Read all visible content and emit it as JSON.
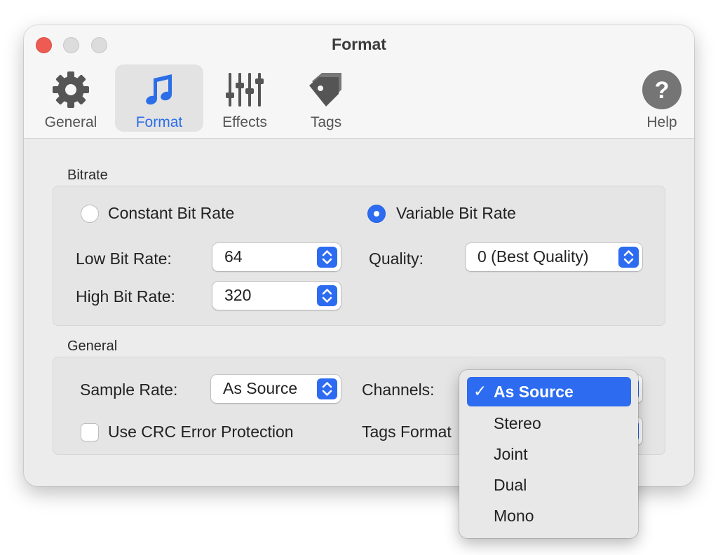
{
  "window": {
    "title": "Format"
  },
  "toolbar": {
    "tabs": [
      {
        "label": "General",
        "icon": "gear-icon"
      },
      {
        "label": "Format",
        "icon": "music-note-icon"
      },
      {
        "label": "Effects",
        "icon": "sliders-icon"
      },
      {
        "label": "Tags",
        "icon": "tag-icon"
      }
    ],
    "active_tab": "Format",
    "help": {
      "label": "Help",
      "icon": "help-icon"
    }
  },
  "bitrate": {
    "section_label": "Bitrate",
    "constant_label": "Constant Bit Rate",
    "variable_label": "Variable Bit Rate",
    "selected_mode": "Variable Bit Rate",
    "low_label": "Low Bit Rate:",
    "low_value": "64",
    "high_label": "High Bit Rate:",
    "high_value": "320",
    "quality_label": "Quality:",
    "quality_value": "0 (Best Quality)"
  },
  "general": {
    "section_label": "General",
    "sample_rate_label": "Sample Rate:",
    "sample_rate_value": "As Source",
    "channels_label": "Channels:",
    "crc_label": "Use CRC Error Protection",
    "crc_checked": false,
    "tags_format_label": "Tags Format"
  },
  "channels_menu": {
    "items": [
      "As Source",
      "Stereo",
      "Joint",
      "Dual",
      "Mono"
    ],
    "selected": "As Source",
    "checkmark": "✓"
  },
  "colors": {
    "accent": "#2d6cf0",
    "close_button": "#ee5b52",
    "window_bg": "#ececec"
  }
}
